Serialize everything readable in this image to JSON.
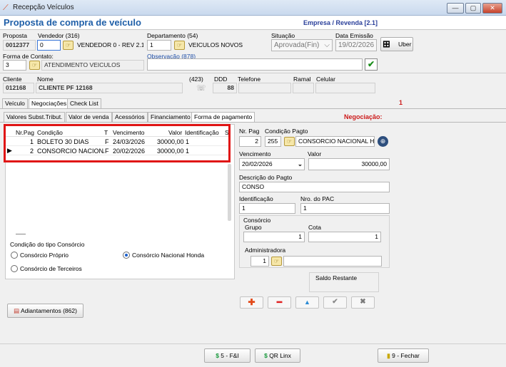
{
  "window": {
    "title": "Recepção Veículos",
    "min": "—",
    "max": "▢",
    "close": "✕"
  },
  "header": {
    "title": "Proposta de compra de veículo",
    "empresa": "Empresa / Revenda [2.1]"
  },
  "form": {
    "proposta_label": "Proposta",
    "proposta": "0012377",
    "vendedor_label": "Vendedor (316)",
    "vendedor_code": "0",
    "vendedor_name": "VENDEDOR 0 - REV 2.1",
    "departamento_label": "Departamento (54)",
    "departamento_code": "1",
    "departamento_name": "VEICULOS NOVOS",
    "situacao_label": "Situação",
    "situacao": "Aprovada(Fin)",
    "data_emissao_label": "Data Emissão",
    "data_emissao": "19/02/2026",
    "uber_label": "Uber",
    "forma_contato_label": "Forma de Contato:",
    "forma_contato_code": "3",
    "forma_contato_name": "ATENDIMENTO VEICULOS",
    "observacao_label": "Observação (878)",
    "observacao": "",
    "cliente_label": "Cliente",
    "cliente": "012168",
    "nome_label": "Nome",
    "nome": "CLIENTE PF 12168",
    "count_423": "(423)",
    "ddd_label": "DDD",
    "ddd": "88",
    "telefone_label": "Telefone",
    "ramal_label": "Ramal",
    "celular_label": "Celular"
  },
  "tabs_top": [
    "Veículo",
    "Negociações",
    "Check List"
  ],
  "tabs_top_badge": "1",
  "tabs_sub": [
    "Valores Subst.Tribut.",
    "Valor de venda",
    "Acessórios",
    "Financiamento",
    "Forma de pagamento"
  ],
  "negociacao_label": "Negociação:",
  "grid": {
    "columns": [
      "Nr.Pag",
      "Condição",
      "T",
      "Vencimento",
      "Valor",
      "Identificação",
      "S"
    ],
    "rows": [
      {
        "nr": "1",
        "condicao": "BOLETO 30 DIAS",
        "t": "F",
        "vencimento": "24/03/2026",
        "valor": "30000,00",
        "ident": "1"
      },
      {
        "nr": "2",
        "condicao": "CONSORCIO NACIONAL",
        "t": "F",
        "vencimento": "20/02/2026",
        "valor": "30000,00",
        "ident": "1"
      }
    ]
  },
  "consorcio_tipo": {
    "label": "Condição do tipo Consórcio",
    "opt1": "Consórcio Próprio",
    "opt2": "Consórcio Nacional Honda",
    "opt3": "Consórcio de Terceiros"
  },
  "detail": {
    "nrpag_label": "Nr. Pag",
    "nrpag": "2",
    "cond_label": "Condição Pagto",
    "cond_code": "255",
    "cond_name": "CONSORCIO NACIONAL HON",
    "venc_label": "Vencimento",
    "venc": "20/02/2026",
    "valor_label": "Valor",
    "valor": "30000,00",
    "desc_label": "Descrição do Pagto",
    "desc": "CONSO",
    "ident_label": "Identificação",
    "ident": "1",
    "pac_label": "Nro. do PAC",
    "pac": "1",
    "consorcio_label": "Consórcio",
    "grupo_label": "Grupo",
    "grupo": "1",
    "cota_label": "Cota",
    "cota": "1",
    "admin_label": "Administradora",
    "admin_code": "1",
    "saldo_label": "Saldo Restante"
  },
  "adiantamentos": "Adiantamentos (862)",
  "bottom": {
    "fi": "5 - F&I",
    "qr": "QR Linx",
    "fechar": "9 - Fechar"
  }
}
